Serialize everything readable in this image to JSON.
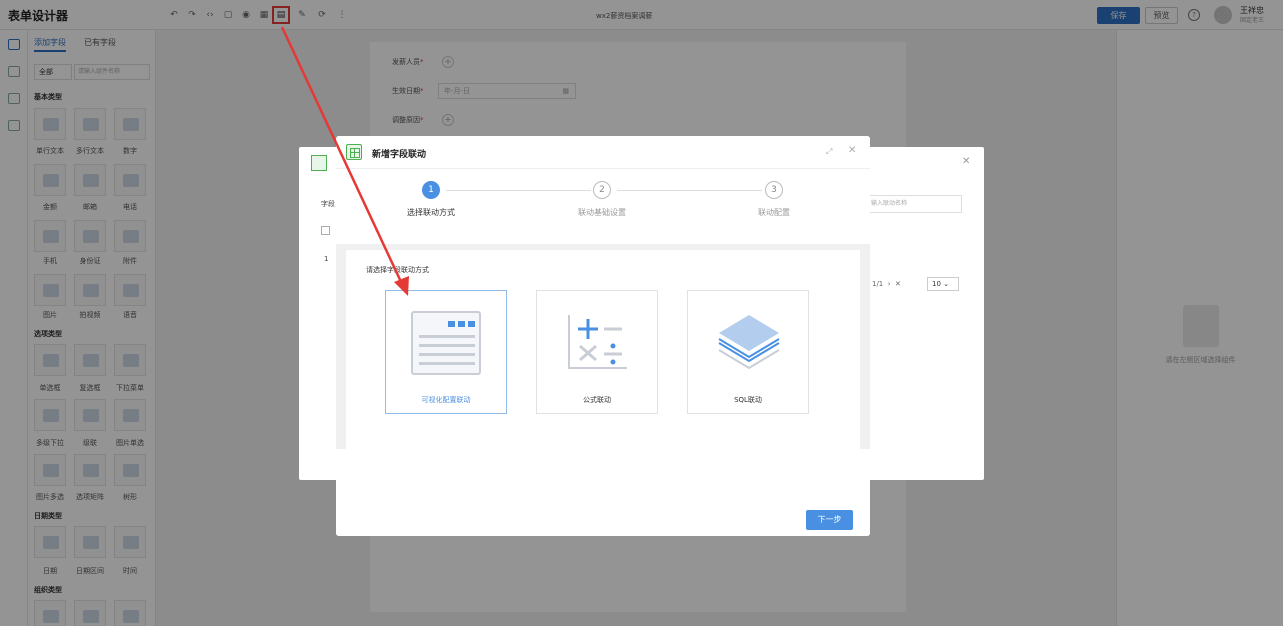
{
  "header": {
    "app_title": "表单设计器",
    "doc_title": "wx2薪资档案调薪",
    "save_label": "保存",
    "preview_label": "预览",
    "user_name": "王祥忠",
    "user_role": "固定老王"
  },
  "toolbar_icons": [
    "undo-icon",
    "redo-icon",
    "code-icon",
    "copy-icon",
    "eye-icon",
    "field-link-icon",
    "edit-icon",
    "refresh-icon",
    "more-icon"
  ],
  "left_panel": {
    "tabs": [
      "添加字段",
      "已有字段"
    ],
    "filter_select": "全部",
    "search_placeholder": "请输入组件名称",
    "sections": [
      {
        "title": "基本类型",
        "fields": [
          "单行文本",
          "多行文本",
          "数字",
          "金额",
          "邮箱",
          "电话",
          "手机",
          "身份证",
          "附件",
          "图片",
          "拍视频",
          "语音"
        ]
      },
      {
        "title": "选项类型",
        "fields": [
          "单选框",
          "复选框",
          "下拉菜单",
          "多级下拉",
          "级联",
          "图片单选",
          "图片多选",
          "选项矩阵",
          "树形"
        ]
      },
      {
        "title": "日期类型",
        "fields": [
          "日期",
          "日期区间",
          "时间"
        ]
      },
      {
        "title": "组织类型",
        "fields": []
      }
    ]
  },
  "form": {
    "rows": [
      {
        "label": "发薪人员",
        "type": "add"
      },
      {
        "label": "生效日期",
        "type": "date",
        "placeholder": "年-月-日"
      },
      {
        "label": "调整原因",
        "type": "add"
      }
    ]
  },
  "back_dialog": {
    "col_label": "字段",
    "row_no": "1",
    "search_placeholder": "输入联动名称",
    "pager": "1/1",
    "page_size": "10"
  },
  "right_panel": {
    "empty_text": "请在左侧区域选择组件"
  },
  "dialog": {
    "title": "新增字段联动",
    "steps": [
      {
        "num": "1",
        "label": "选择联动方式",
        "active": true
      },
      {
        "num": "2",
        "label": "联动基础设置",
        "active": false
      },
      {
        "num": "3",
        "label": "联动配置",
        "active": false
      }
    ],
    "content_label": "请选择字段联动方式",
    "options": [
      {
        "label": "可视化配置联动",
        "selected": true,
        "icon": "visual-config-icon"
      },
      {
        "label": "公式联动",
        "selected": false,
        "icon": "formula-icon"
      },
      {
        "label": "SQL联动",
        "selected": false,
        "icon": "sql-layers-icon"
      }
    ],
    "next_label": "下一步"
  },
  "colors": {
    "primary": "#4a90e2",
    "save": "#2f6fc4",
    "annotation": "#e53935"
  }
}
